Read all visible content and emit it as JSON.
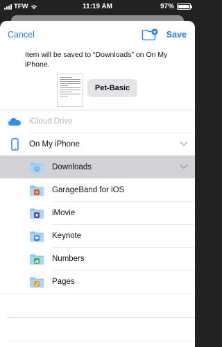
{
  "status_bar": {
    "carrier": "TFW",
    "time": "11:19 AM",
    "battery_percent": "97%",
    "battery_level": 0.97
  },
  "nav": {
    "cancel_label": "Cancel",
    "save_label": "Save",
    "new_folder_icon": "folder-plus-icon"
  },
  "message": "Item will be saved to “Downloads” on On My iPhone.",
  "file_name": "Pet-Basic",
  "locations": [
    {
      "label": "iCloud Drive",
      "icon": "cloud-icon",
      "enabled": false
    },
    {
      "label": "On My iPhone",
      "icon": "iphone-icon",
      "expanded": true
    }
  ],
  "folders": [
    {
      "label": "Downloads",
      "icon": "download-folder-icon",
      "selected": true
    },
    {
      "label": "GarageBand for iOS",
      "icon": "garageband-folder-icon"
    },
    {
      "label": "iMovie",
      "icon": "imovie-folder-icon"
    },
    {
      "label": "Keynote",
      "icon": "keynote-folder-icon"
    },
    {
      "label": "Numbers",
      "icon": "numbers-folder-icon"
    },
    {
      "label": "Pages",
      "icon": "pages-folder-icon"
    }
  ],
  "colors": {
    "accent": "#1a7cf5",
    "selected_row": "#d1d1d6",
    "folder": "#8ec8f2"
  }
}
